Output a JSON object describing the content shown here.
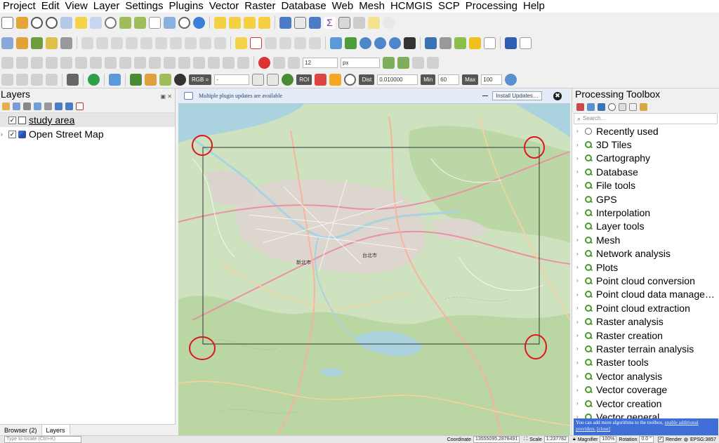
{
  "menu": [
    "Project",
    "Edit",
    "View",
    "Layer",
    "Settings",
    "Plugins",
    "Vector",
    "Raster",
    "Database",
    "Web",
    "Mesh",
    "HCMGIS",
    "SCP",
    "Processing",
    "Help"
  ],
  "toolbar": {
    "snapping_tolerance": "12",
    "snapping_units": "px",
    "rgb_label": "RGB =",
    "rgb_value": "-",
    "roi_label": "ROI",
    "dist_label": "Dist",
    "dist_value": "0.010000",
    "min_label": "Min",
    "min_value": "60",
    "max_label": "Max",
    "max_value": "100"
  },
  "layers_panel": {
    "title": "Layers",
    "items": [
      {
        "name": "study area",
        "checked": true
      },
      {
        "name": "Open Street Map",
        "checked": true
      }
    ]
  },
  "bottom_tabs": [
    "Browser (2)",
    "Layers"
  ],
  "message_bar": {
    "text": "Multiple plugin updates are available",
    "button": "Install Updates…",
    "close_symbol": "✖"
  },
  "processing_toolbox": {
    "title": "Processing Toolbox",
    "search_placeholder": "Search…",
    "items": [
      "Recently used",
      "3D Tiles",
      "Cartography",
      "Database",
      "File tools",
      "GPS",
      "Interpolation",
      "Layer tools",
      "Mesh",
      "Network analysis",
      "Plots",
      "Point cloud conversion",
      "Point cloud data manage…",
      "Point cloud extraction",
      "Raster analysis",
      "Raster creation",
      "Raster terrain analysis",
      "Raster tools",
      "Vector analysis",
      "Vector coverage",
      "Vector creation",
      "Vector general"
    ],
    "footer_text": "You can add more algorithms to the toolbox,",
    "footer_link": "enable additional providers.",
    "footer_close": "[close]"
  },
  "statusbar": {
    "locator_placeholder": "Type to locate (Ctrl+K)",
    "coordinate_label": "Coordinate",
    "coordinate_value": "13555095,2878491",
    "scale_label": "Scale",
    "scale_value": "1:237782",
    "magnifier_label": "Magnifier",
    "magnifier_value": "100%",
    "rotation_label": "Rotation",
    "rotation_value": "0.0 °",
    "render_label": "Render",
    "crs_label": "EPSG:3857"
  },
  "map": {
    "labels": [
      "台北市",
      "新北市"
    ],
    "highlight_color": "#e0141e",
    "study_area_color": "#333333"
  }
}
